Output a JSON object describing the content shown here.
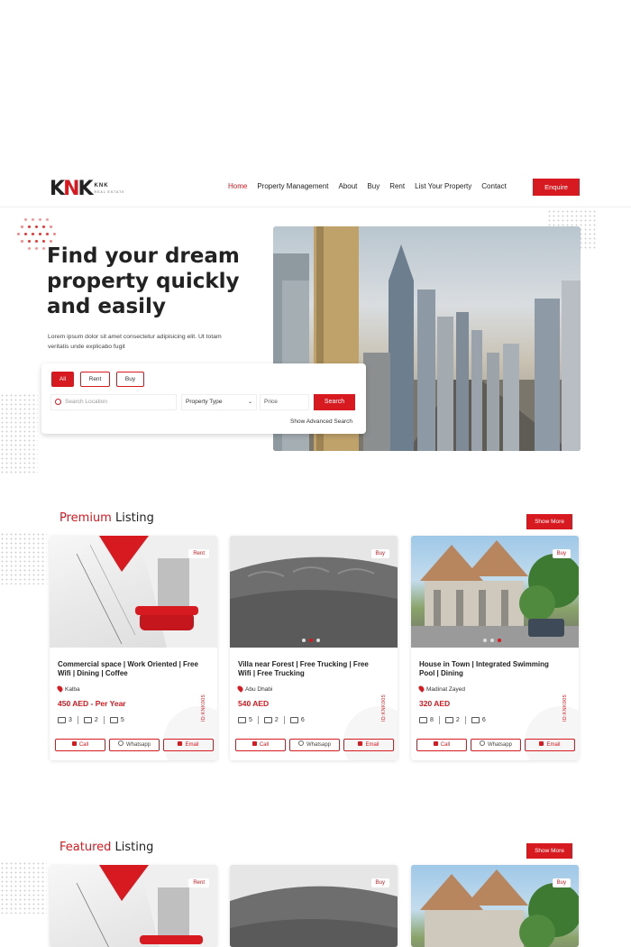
{
  "brand": {
    "mark_left": "K",
    "mark_mid": "N",
    "mark_right": "K",
    "name": "KNK",
    "tagline": "REAL ESTATE"
  },
  "nav": {
    "items": [
      {
        "label": "Home",
        "active": true
      },
      {
        "label": "Property Management"
      },
      {
        "label": "About"
      },
      {
        "label": "Buy"
      },
      {
        "label": "Rent"
      },
      {
        "label": "List Your Property"
      },
      {
        "label": "Contact"
      }
    ],
    "enquire_label": "Enquire"
  },
  "hero": {
    "title_line1": "Find your dream",
    "title_line2": "property quickly",
    "title_line3": "and easily",
    "description": "Lorem ipsum dolor sit amet consectetur adipisicing elit. Ut totam veritatis unde explicabo fugit"
  },
  "search": {
    "tabs": [
      "All",
      "Rent",
      "Buy"
    ],
    "location_placeholder": "Search Location",
    "property_type": "Property Type",
    "price_placeholder": "Price",
    "button_label": "Search",
    "advanced_label": "Show Advanced Search"
  },
  "premium": {
    "title_highlight": "Premium",
    "title_rest": " Listing",
    "show_more": "Show More",
    "cards": [
      {
        "badge": "Rent",
        "title": "Commercial space | Work Oriented | Free Wifi | Dining | Coffee",
        "location": "Kalba",
        "price": "450 AED - Per Year",
        "beds": "3",
        "baths": "2",
        "area": "5",
        "id": "ID:KNK005",
        "call": "Call",
        "whatsapp": "Whatsapp",
        "email": "Email"
      },
      {
        "badge": "Buy",
        "title": "Villa near Forest | Free Trucking | Free Wifi | Free Trucking",
        "location": "Abu Dhabi",
        "price": "540 AED",
        "beds": "5",
        "baths": "2",
        "area": "6",
        "id": "ID:KNK005",
        "call": "Call",
        "whatsapp": "Whatsapp",
        "email": "Email"
      },
      {
        "badge": "Buy",
        "title": "House in Town | Integrated Swimming Pool | Dining",
        "location": "Madinat Zayed",
        "price": "320 AED",
        "beds": "8",
        "baths": "2",
        "area": "6",
        "id": "ID:KNK005",
        "call": "Call",
        "whatsapp": "Whatsapp",
        "email": "Email"
      }
    ]
  },
  "featured": {
    "title_highlight": "Featured",
    "title_rest": " Listing",
    "show_more": "Show More",
    "cards": [
      {
        "badge": "Rent"
      },
      {
        "badge": "Buy"
      },
      {
        "badge": "Buy"
      }
    ]
  },
  "colors": {
    "accent": "#d71920",
    "text": "#222222"
  },
  "icons": [
    "map-pin-icon",
    "bed-icon",
    "bath-icon",
    "area-icon",
    "phone-icon",
    "whatsapp-icon",
    "email-icon",
    "chevron-down-icon"
  ]
}
